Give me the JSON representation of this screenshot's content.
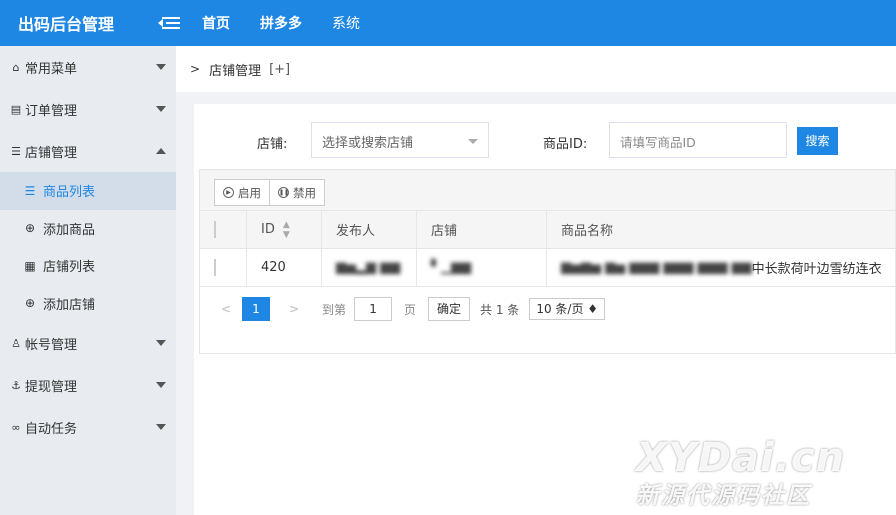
{
  "header": {
    "logo": "出码后台管理",
    "nav": [
      "首页",
      "拼多多",
      "系统"
    ]
  },
  "sidebar": {
    "groups": [
      {
        "icon": "home-icon",
        "label": "常用菜单",
        "expanded": false
      },
      {
        "icon": "order-icon",
        "label": "订单管理",
        "expanded": false
      },
      {
        "icon": "list-icon",
        "label": "店铺管理",
        "expanded": true,
        "items": [
          {
            "icon": "list-icon",
            "label": "商品列表",
            "active": true
          },
          {
            "icon": "plus-circle-icon",
            "label": "添加商品"
          },
          {
            "icon": "grid-icon",
            "label": "店铺列表"
          },
          {
            "icon": "plus-circle-icon",
            "label": "添加店铺"
          }
        ]
      },
      {
        "icon": "user-icon",
        "label": "帐号管理",
        "expanded": false
      },
      {
        "icon": "anchor-icon",
        "label": "提现管理",
        "expanded": false
      },
      {
        "icon": "link-icon",
        "label": "自动任务",
        "expanded": false
      }
    ]
  },
  "breadcrumb": {
    "arrow": ">",
    "title": "店铺管理",
    "plus": "[+]"
  },
  "search": {
    "store_label": "店铺:",
    "store_placeholder": "选择或搜索店铺",
    "goods_label": "商品ID:",
    "goods_placeholder": "请填写商品ID",
    "search_btn": "搜索"
  },
  "toolbar": {
    "enable": "启用",
    "disable": "禁用"
  },
  "table": {
    "headers": [
      "ID",
      "发布人",
      "店铺",
      "商品名称"
    ],
    "rows": [
      {
        "id": "420",
        "publisher": "▆▅▂▆ ▆▆",
        "store": "▘▁▆▆",
        "name_blurred": "▆▅▆▅ ▆▅ ▆▆▆ ▆▆▆ ▆▆▆ ▆▆",
        "name_visible": "中长款荷叶边雪纺连衣"
      }
    ]
  },
  "pager": {
    "prev": "<",
    "current": "1",
    "next": ">",
    "goto_label": "到第",
    "goto_value": "1",
    "page_unit": "页",
    "confirm": "确定",
    "total": "共 1 条",
    "page_size": "10 条/页 ♦"
  },
  "watermark": {
    "line1": "XYDai.cn",
    "line2": "新源代源码社区"
  }
}
